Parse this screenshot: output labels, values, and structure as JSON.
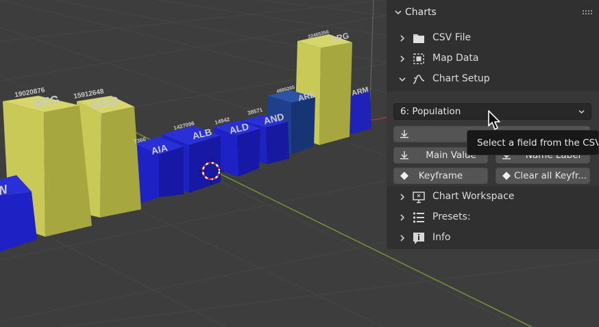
{
  "viewport": {
    "bars": [
      {
        "label": "W",
        "value": ""
      },
      {
        "label": "AFG",
        "value": "19020876"
      },
      {
        "label": "AGO",
        "value": "15912648"
      },
      {
        "label": "AIA",
        "value": "7366"
      },
      {
        "label": "ALB",
        "value": "1427096"
      },
      {
        "label": "ALD",
        "value": "14942"
      },
      {
        "label": "AND",
        "value": "38571"
      },
      {
        "label": "ARE",
        "value": "4885265"
      },
      {
        "label": "ARG",
        "value": "22465356"
      },
      {
        "label": "ARM",
        "value": ""
      }
    ],
    "colors": {
      "blue": "#1e23c8",
      "yellow": "#bdbd4a",
      "grid": "#4a4a4a",
      "x_axis": "#6f9630",
      "y_axis": "#9a3b3b"
    }
  },
  "panel": {
    "title": "Charts",
    "sections": [
      {
        "label": "CSV File",
        "icon": "folder-icon",
        "expanded": false
      },
      {
        "label": "Map Data",
        "icon": "map-data-icon",
        "expanded": false
      },
      {
        "label": "Chart Setup",
        "icon": "curve-icon",
        "expanded": true
      },
      {
        "label": "Chart Workspace",
        "icon": "monitor-icon",
        "expanded": false
      },
      {
        "label": "Presets:",
        "icon": "list-icon",
        "expanded": false
      },
      {
        "label": "Info",
        "icon": "info-icon",
        "expanded": false
      }
    ],
    "chart_setup": {
      "field_select": "6: Population",
      "main_value_button": "Main Value",
      "name_label_button": "Name Label",
      "keyframe_button": "Keyframe",
      "clear_keyframes_button": "Clear all Keyfr..."
    }
  },
  "tooltip": {
    "text": "Select a field from the CSV"
  }
}
